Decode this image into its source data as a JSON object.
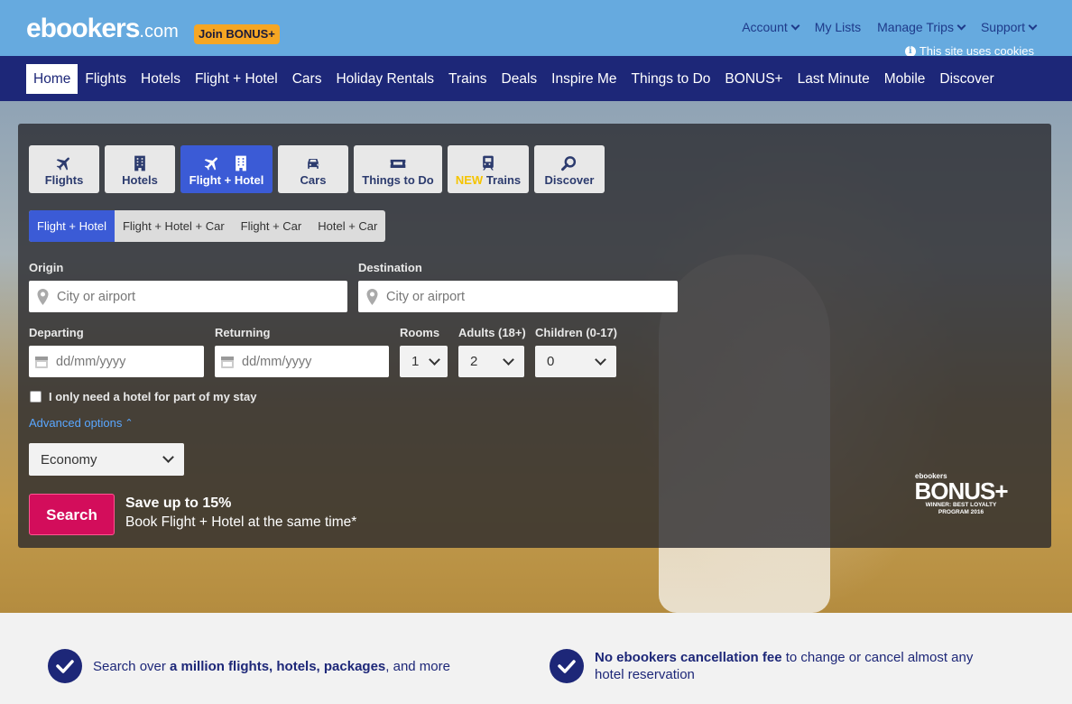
{
  "header": {
    "logo_main": "ebookers",
    "logo_suffix": ".com",
    "join_bonus": "Join BONUS+",
    "links": [
      "Account",
      "My Lists",
      "Manage Trips",
      "Support"
    ],
    "cookies": "This site uses cookies"
  },
  "nav": {
    "items": [
      "Home",
      "Flights",
      "Hotels",
      "Flight + Hotel",
      "Cars",
      "Holiday Rentals",
      "Trains",
      "Deals",
      "Inspire Me",
      "Things to Do",
      "BONUS+",
      "Last Minute",
      "Mobile",
      "Discover"
    ],
    "active": "Home"
  },
  "product_tabs": {
    "flights": "Flights",
    "hotels": "Hotels",
    "flight_hotel": "Flight + Hotel",
    "cars": "Cars",
    "things": "Things to Do",
    "trains_new": "NEW",
    "trains": "Trains",
    "discover": "Discover"
  },
  "sub_tabs": [
    "Flight + Hotel",
    "Flight + Hotel + Car",
    "Flight + Car",
    "Hotel + Car"
  ],
  "form": {
    "origin_label": "Origin",
    "origin_placeholder": "City or airport",
    "destination_label": "Destination",
    "destination_placeholder": "City or airport",
    "departing_label": "Departing",
    "departing_placeholder": "dd/mm/yyyy",
    "returning_label": "Returning",
    "returning_placeholder": "dd/mm/yyyy",
    "rooms_label": "Rooms",
    "rooms_value": "1",
    "adults_label": "Adults (18+)",
    "adults_value": "2",
    "children_label": "Children (0-17)",
    "children_value": "0",
    "partial_stay": "I only need a hotel for part of my stay",
    "advanced": "Advanced options",
    "cabin_value": "Economy",
    "search": "Search"
  },
  "promo": {
    "line1": "Save up to 15%",
    "line2": "Book Flight + Hotel at the same time*"
  },
  "badge": {
    "brand": "ebookers",
    "name": "BONUS+",
    "award1": "WINNER: BEST LOYALTY",
    "award2": "PROGRAM 2016"
  },
  "features": [
    {
      "pre": "Search over ",
      "bold": "a million flights, hotels, packages",
      "post": ", and more"
    },
    {
      "pre": "",
      "bold": "No ebookers cancellation fee",
      "post": " to change or cancel almost any hotel reservation"
    }
  ],
  "colors": {
    "topbar": "#66aadf",
    "navbar": "#1d2778",
    "accent": "#3b5bd6",
    "search": "#d30d5b",
    "bonus": "#f6a623"
  }
}
